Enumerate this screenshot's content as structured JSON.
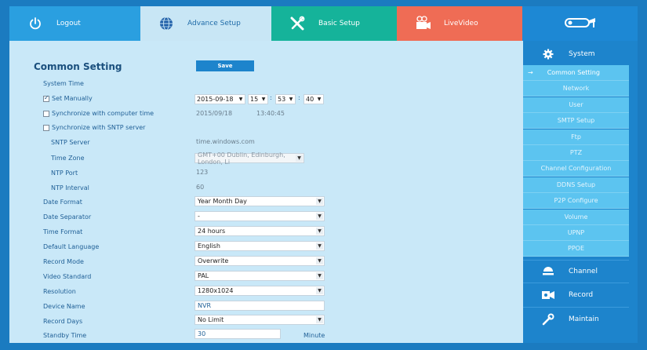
{
  "nav": {
    "logout": "Logout",
    "advance": "Advance Setup",
    "basic": "Basic Setup",
    "live": "LiveVideo"
  },
  "main": {
    "title": "Common Setting",
    "save": "Save",
    "system_time": "System Time",
    "set_manually": "Set Manually",
    "sync_computer": "Synchronize with computer time",
    "sync_sntp": "Synchronize with SNTP server",
    "sntp_server": "SNTP Server",
    "time_zone": "Time Zone",
    "ntp_port": "NTP Port",
    "ntp_interval": "NTP Interval",
    "date_format": "Date Format",
    "date_separator": "Date Separator",
    "time_format": "Time Format",
    "default_language": "Default Language",
    "record_mode": "Record Mode",
    "video_standard": "Video Standard",
    "resolution": "Resolution",
    "device_name": "Device Name",
    "record_days": "Record Days",
    "standby_time": "Standby Time",
    "minute": "Minute"
  },
  "values": {
    "date": "2015-09-18",
    "hour": "15",
    "minute": "53",
    "second": "40",
    "computer_date": "2015/09/18",
    "computer_time": "13:40:45",
    "sntp_server": "time.windows.com",
    "time_zone": "GMT+00 Dublin, Edinburgh, London, Li",
    "ntp_port": "123",
    "ntp_interval": "60",
    "date_format": "Year Month Day",
    "date_separator": "-",
    "time_format": "24 hours",
    "default_language": "English",
    "record_mode": "Overwrite",
    "video_standard": "PAL",
    "resolution": "1280x1024",
    "device_name": "NVR",
    "record_days": "No Limit",
    "standby_time": "30",
    "set_manually_checked": true,
    "sync_computer_checked": false,
    "sync_sntp_checked": false
  },
  "sidebar": {
    "system": "System",
    "items": [
      "Common Setting",
      "Network",
      "User",
      "SMTP Setup",
      "Ftp",
      "PTZ",
      "Channel Configuration",
      "DDNS Setup",
      "P2P Configure",
      "Volume",
      "UPNP",
      "PPOE"
    ],
    "active_index": 0,
    "channel": "Channel",
    "record": "Record",
    "maintain": "Maintain"
  },
  "colors": {
    "frame": "#1b7bc0",
    "logout_tab": "#2a9fe0",
    "advance_tab": "#c8e6f5",
    "basic_tab": "#15b39a",
    "live_tab": "#ef6c55",
    "save_button": "#1d84cc",
    "sidebar_sub": "#5cc4f0"
  },
  "icons": {
    "logout": "power-icon",
    "advance": "globe-icon",
    "basic": "tools-icon",
    "live": "camera-icon",
    "logo": "cctv-camera-icon",
    "system": "gear-icon",
    "channel": "dome-camera-icon",
    "record": "video-record-icon",
    "maintain": "wrench-icon"
  }
}
